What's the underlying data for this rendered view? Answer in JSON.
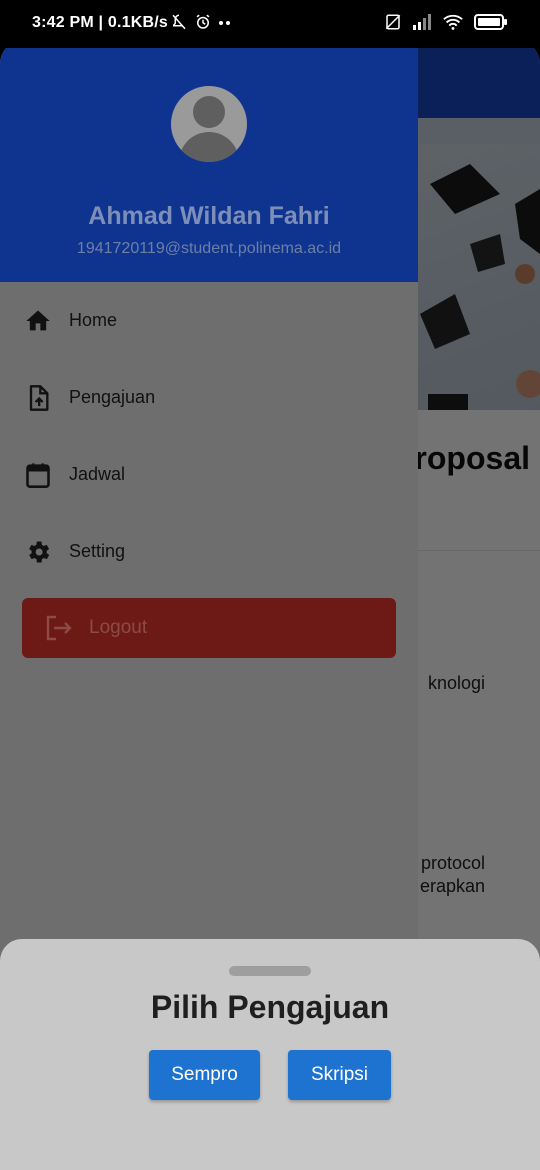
{
  "status_bar": {
    "time": "3:42 PM",
    "net_speed": "| 0.1KB/s",
    "icons": [
      "bell-off-icon",
      "alarm-icon",
      "more-dots-icon",
      "sim-off-icon",
      "signal-icon",
      "wifi-icon",
      "battery-icon"
    ]
  },
  "background_page": {
    "heading_fragment": "roposal",
    "text_fragment_1": "knologi",
    "text_fragment_2_line1": "protocol",
    "text_fragment_2_line2": "erapkan"
  },
  "drawer": {
    "user_name": "Ahmad Wildan Fahri",
    "user_email": "1941720119@student.polinema.ac.id",
    "menu_items": [
      {
        "label": "Home",
        "icon": "home-icon"
      },
      {
        "label": "Pengajuan",
        "icon": "file-upload-icon"
      },
      {
        "label": "Jadwal",
        "icon": "calendar-icon"
      },
      {
        "label": "Setting",
        "icon": "gear-icon"
      }
    ],
    "logout_label": "Logout",
    "colors": {
      "header": "#0f3490",
      "logout": "#6d1a17"
    }
  },
  "sheet": {
    "title": "Pilih Pengajuan",
    "buttons": [
      {
        "label": "Sempro"
      },
      {
        "label": "Skripsi"
      }
    ],
    "button_color": "#1e73d0"
  }
}
